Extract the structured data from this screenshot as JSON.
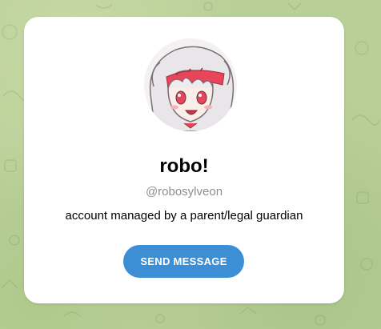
{
  "profile": {
    "name": "robo!",
    "username": "@robosylveon",
    "bio": "account managed by a parent/legal guardian",
    "avatar_icon": "anime-character-avatar"
  },
  "actions": {
    "send_message_label": "SEND MESSAGE"
  },
  "colors": {
    "background": "#b9cf98",
    "card": "#ffffff",
    "button": "#3c8fd4",
    "username": "#8e8e8e"
  }
}
